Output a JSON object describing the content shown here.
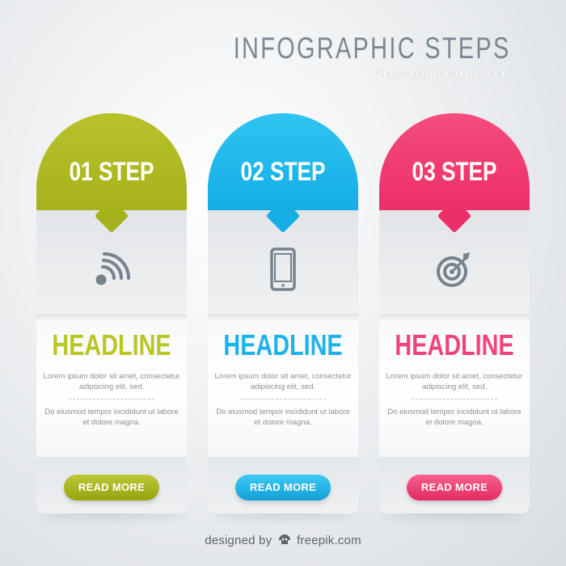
{
  "title": {
    "main": "INFOGRAPHIC STEPS",
    "sub": "VECTOR TEMPLATE"
  },
  "cards": [
    {
      "step": "01 STEP",
      "icon": "wifi-signal-icon",
      "headline": "HEADLINE",
      "text1": "Lorem ipsum dolor sit amet, consectetur adipiscing elit, sed.",
      "text2": "Do eiusmod tempor incididunt ut labore et dolore magna.",
      "button": "READ MORE",
      "color": "#b2be22"
    },
    {
      "step": "02 STEP",
      "icon": "smartphone-icon",
      "headline": "HEADLINE",
      "text1": "Lorem ipsum dolor sit amet, consectetur adipiscing elit, sed.",
      "text2": "Do eiusmod tempor incididunt ut labore et dolore magna.",
      "button": "READ MORE",
      "color": "#1cb2ea"
    },
    {
      "step": "03 STEP",
      "icon": "target-icon",
      "headline": "HEADLINE",
      "text1": "Lorem ipsum dolor sit amet, consectetur adipiscing elit, sed.",
      "text2": "Do eiusmod tempor incididunt ut labore et dolore magna.",
      "button": "READ MORE",
      "color": "#ef4479"
    }
  ],
  "footer": {
    "prefix": "designed by",
    "brand": "freepik.com"
  }
}
